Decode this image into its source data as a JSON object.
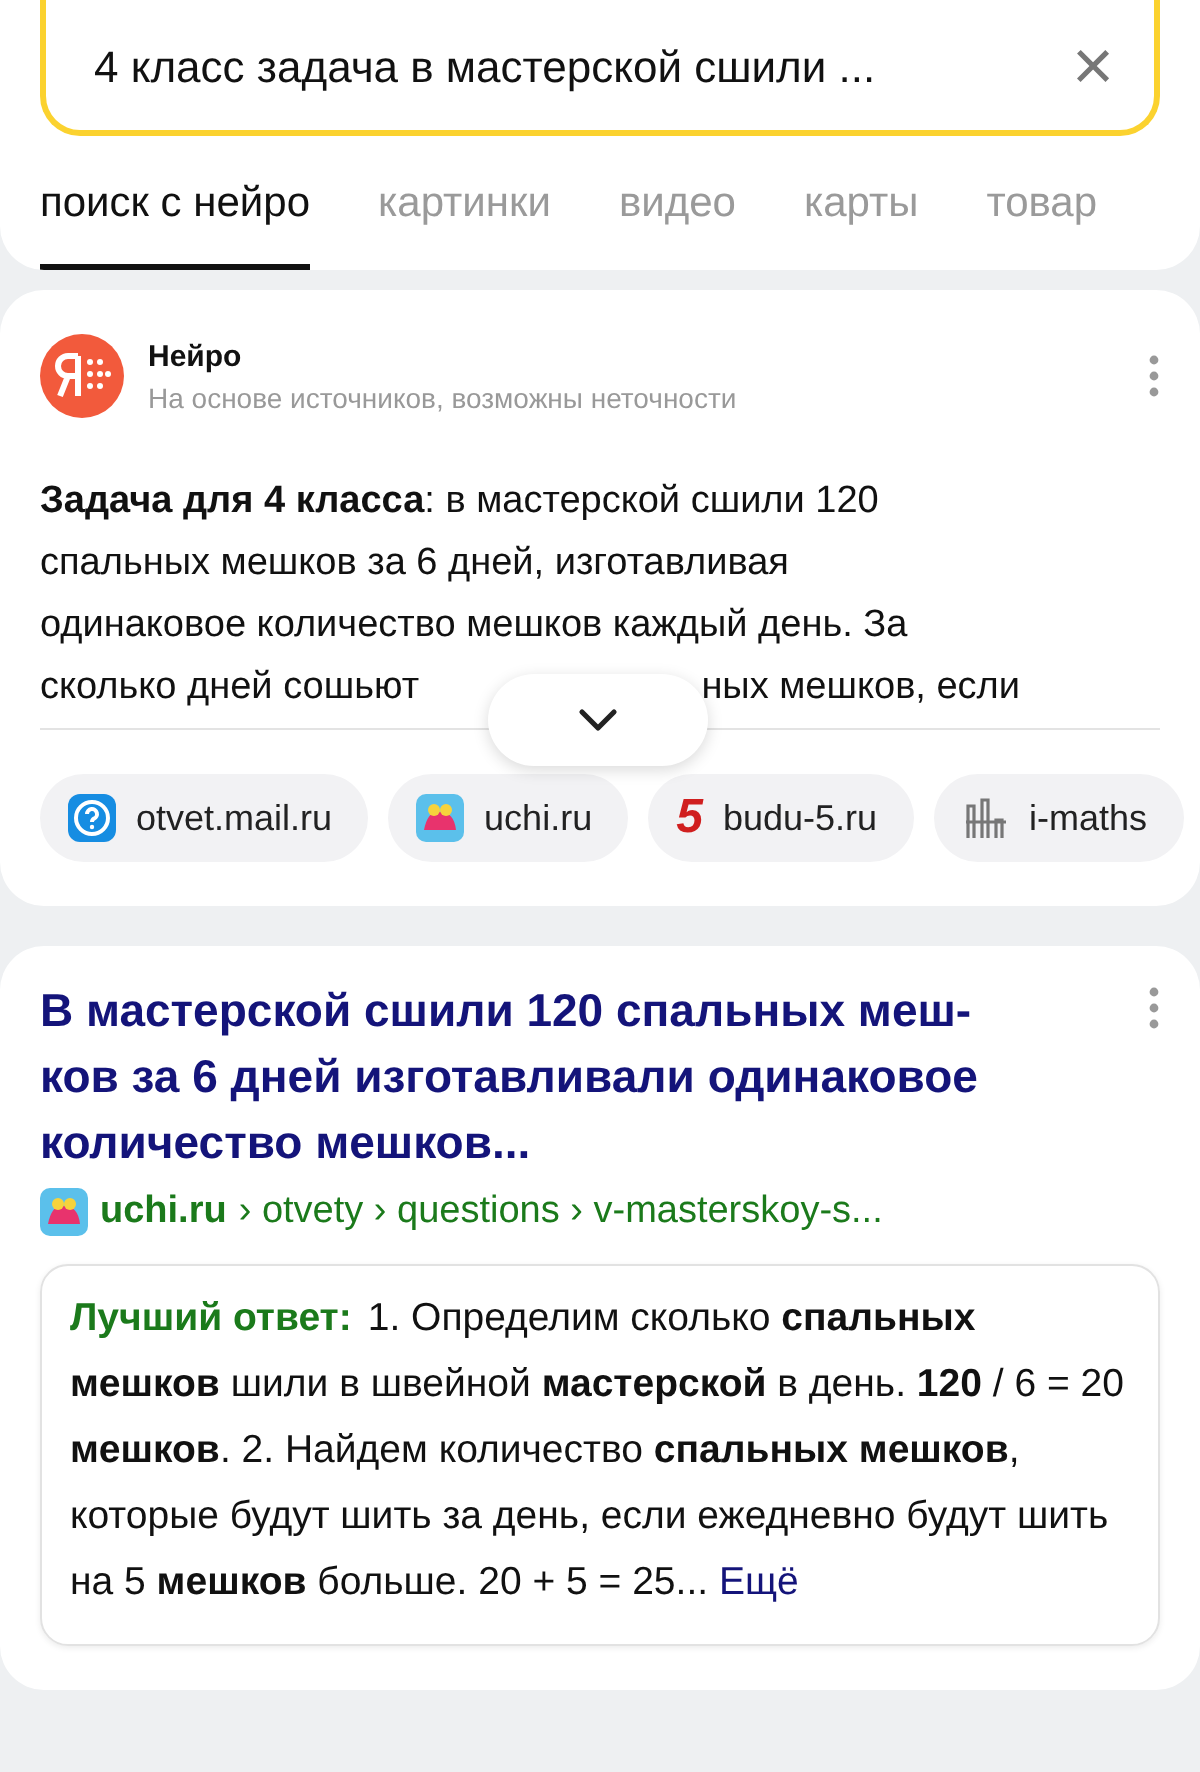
{
  "search": {
    "value": "4 класс задача в мастерской сшили ...",
    "clear": "×"
  },
  "tabs": [
    {
      "label": "поиск с нейро",
      "selected": true
    },
    {
      "label": "картинки",
      "selected": false
    },
    {
      "label": "видео",
      "selected": false
    },
    {
      "label": "карты",
      "selected": false
    },
    {
      "label": "товар",
      "selected": false
    }
  ],
  "neuro": {
    "title": "Нейро",
    "subtitle": "На основе источников, возможны неточности",
    "text": "**Задача для 4 класса**: в мастерской сшили 120\nспальных мешков за 6 дней, изготавливая\nодинаковое количество мешков каждый день. За",
    "cut_left": "сколько дней сошьют",
    "cut_right": "ных мешков, если",
    "sources": [
      {
        "kind": "mail",
        "label": "otvet.mail.ru"
      },
      {
        "kind": "uchi",
        "label": "uchi.ru"
      },
      {
        "kind": "five",
        "label": "budu-5.ru",
        "mark": "5"
      },
      {
        "kind": "maths",
        "label": "i-maths"
      }
    ]
  },
  "result": {
    "title": "В мастерской сшили 120 спальных меш-\nков за 6 дней изготавливали одинаковое\nколичество **мешков**...",
    "site": "uchi.ru",
    "path": "› otvety › questions › v-masterskoy-s...",
    "answer_label": "Лучший ответ:",
    "answer": "1. Определим сколько **спальных мешков** шили в швейной **мастерской** в день. **120** / 6 = 20 **мешков**. 2. Найдем количество **спальных мешков**, которые будут шить за день, если ежедневно будут шить на 5 **мешков** больше. 20 + 5 = 25...",
    "more": "Ещё"
  }
}
